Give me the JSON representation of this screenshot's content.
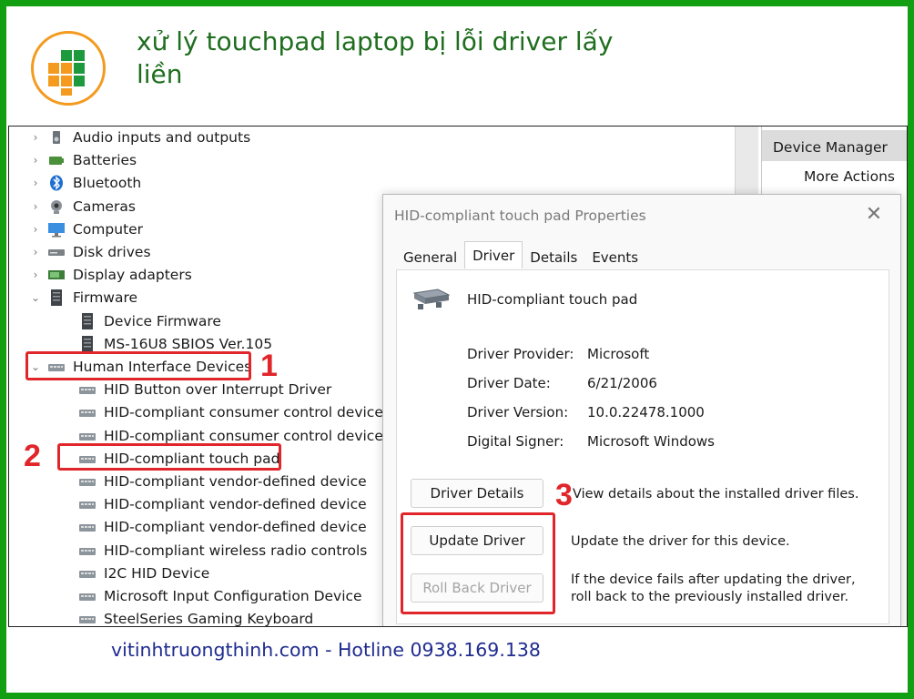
{
  "header": {
    "title": "xử lý touchpad laptop bị lỗi driver lấy liền"
  },
  "tree": {
    "items": [
      {
        "label": "Audio inputs and outputs",
        "chev": "›",
        "icon": "speaker-icon",
        "indent": 0
      },
      {
        "label": "Batteries",
        "chev": "›",
        "icon": "battery-icon",
        "indent": 0
      },
      {
        "label": "Bluetooth",
        "chev": "›",
        "icon": "bluetooth-icon",
        "indent": 0
      },
      {
        "label": "Cameras",
        "chev": "›",
        "icon": "camera-icon",
        "indent": 0
      },
      {
        "label": "Computer",
        "chev": "›",
        "icon": "monitor-icon",
        "indent": 0
      },
      {
        "label": "Disk drives",
        "chev": "›",
        "icon": "disk-drive-icon",
        "indent": 0
      },
      {
        "label": "Display adapters",
        "chev": "›",
        "icon": "display-adapter-icon",
        "indent": 0
      },
      {
        "label": "Firmware",
        "chev": "⌄",
        "icon": "firmware-icon",
        "indent": 0
      },
      {
        "label": "Device Firmware",
        "chev": "",
        "icon": "firmware-icon",
        "indent": 1
      },
      {
        "label": "MS-16U8 SBIOS Ver.105",
        "chev": "",
        "icon": "firmware-icon",
        "indent": 1
      },
      {
        "label": "Human Interface Devices",
        "chev": "⌄",
        "icon": "hid-device-icon",
        "indent": 0
      },
      {
        "label": "HID Button over Interrupt Driver",
        "chev": "",
        "icon": "hid-device-icon",
        "indent": 1
      },
      {
        "label": "HID-compliant consumer control device",
        "chev": "",
        "icon": "hid-device-icon",
        "indent": 1
      },
      {
        "label": "HID-compliant consumer control device",
        "chev": "",
        "icon": "hid-device-icon",
        "indent": 1
      },
      {
        "label": "HID-compliant touch pad",
        "chev": "",
        "icon": "hid-device-icon",
        "indent": 1
      },
      {
        "label": "HID-compliant vendor-defined device",
        "chev": "",
        "icon": "hid-device-icon",
        "indent": 1
      },
      {
        "label": "HID-compliant vendor-defined device",
        "chev": "",
        "icon": "hid-device-icon",
        "indent": 1
      },
      {
        "label": "HID-compliant vendor-defined device",
        "chev": "",
        "icon": "hid-device-icon",
        "indent": 1
      },
      {
        "label": "HID-compliant wireless radio controls",
        "chev": "",
        "icon": "hid-device-icon",
        "indent": 1
      },
      {
        "label": "I2C HID Device",
        "chev": "",
        "icon": "hid-device-icon",
        "indent": 1
      },
      {
        "label": "Microsoft Input Configuration Device",
        "chev": "",
        "icon": "hid-device-icon",
        "indent": 1
      },
      {
        "label": "SteelSeries Gaming Keyboard",
        "chev": "",
        "icon": "hid-device-icon",
        "indent": 1
      }
    ]
  },
  "actions": {
    "header": "Device Manager",
    "more": "More Actions"
  },
  "dialog": {
    "title": "HID-compliant touch pad Properties",
    "close": "✕",
    "tabs": [
      "General",
      "Driver",
      "Details",
      "Events"
    ],
    "selected_tab": "Driver",
    "device_name": "HID-compliant touch pad",
    "fields": [
      {
        "key": "Driver Provider:",
        "value": "Microsoft"
      },
      {
        "key": "Driver Date:",
        "value": "6/21/2006"
      },
      {
        "key": "Driver Version:",
        "value": "10.0.22478.1000"
      },
      {
        "key": "Digital Signer:",
        "value": "Microsoft Windows"
      }
    ],
    "buttons": {
      "details": "Driver Details",
      "details_desc": "View details about the installed driver files.",
      "update": "Update Driver",
      "update_desc": "Update the driver for this device.",
      "rollback": "Roll Back Driver",
      "rollback_desc": "If the device fails after updating the driver, roll back to the previously installed driver."
    }
  },
  "annotations": {
    "n1": "1",
    "n2": "2",
    "n3": "3"
  },
  "footer": {
    "text": "vitinhtruongthinh.com - Hotline 0938.169.138"
  },
  "colors": {
    "frame": "#12a012",
    "title": "#1f6e1f",
    "highlight": "#e0262a",
    "footer": "#1f2b8f"
  }
}
